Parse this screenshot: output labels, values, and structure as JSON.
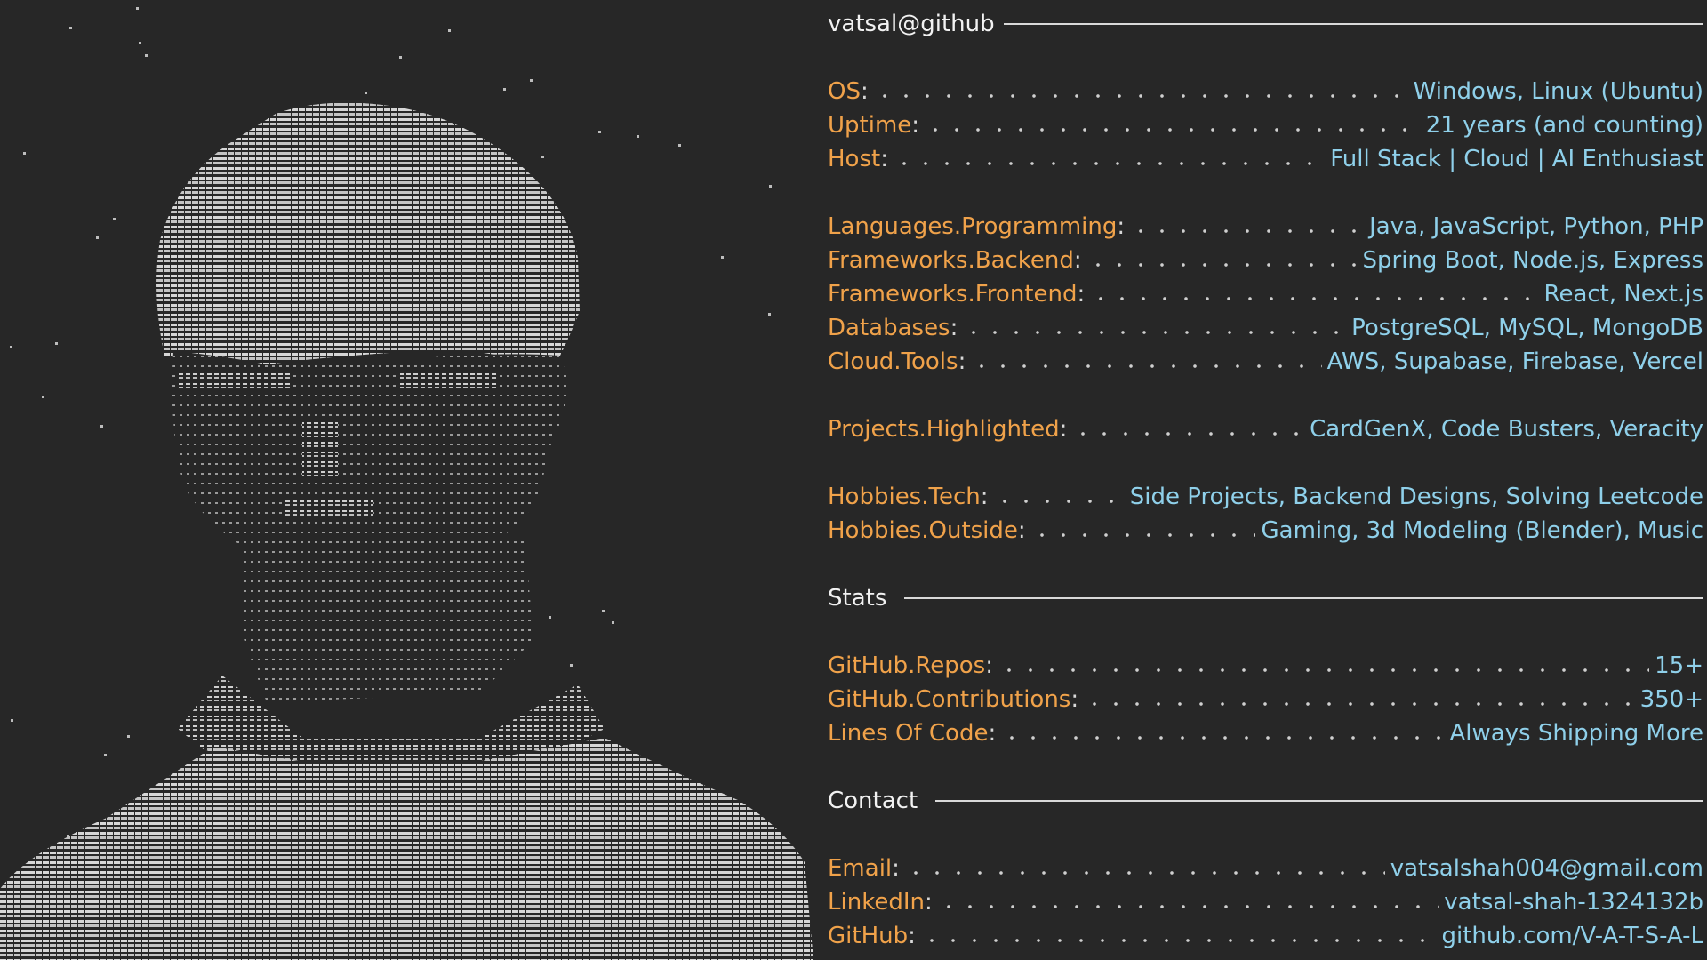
{
  "header": {
    "title": "vatsal@github"
  },
  "system": [
    {
      "key": "OS",
      "value": "Windows, Linux (Ubuntu)"
    },
    {
      "key": "Uptime",
      "value": "21 years (and counting)"
    },
    {
      "key": "Host",
      "value": "Full Stack | Cloud | AI Enthusiast"
    }
  ],
  "stack": [
    {
      "key": "Languages.Programming",
      "value": "Java, JavaScript, Python, PHP"
    },
    {
      "key": "Frameworks.Backend",
      "value": "Spring Boot, Node.js, Express"
    },
    {
      "key": "Frameworks.Frontend",
      "value": "React, Next.js"
    },
    {
      "key": "Databases",
      "value": "PostgreSQL, MySQL, MongoDB"
    },
    {
      "key": "Cloud.Tools",
      "value": "AWS, Supabase, Firebase, Vercel"
    }
  ],
  "projects": [
    {
      "key": "Projects.Highlighted",
      "value": "CardGenX,  Code Busters, Veracity"
    }
  ],
  "hobbies": [
    {
      "key": "Hobbies.Tech",
      "value": "Side Projects, Backend Designs, Solving Leetcode"
    },
    {
      "key": "Hobbies.Outside",
      "value": "Gaming, 3d Modeling (Blender), Music"
    }
  ],
  "stats": {
    "title": "Stats",
    "items": [
      {
        "key": "GitHub.Repos",
        "value": "15+"
      },
      {
        "key": "GitHub.Contributions",
        "value": "350+"
      },
      {
        "key": "Lines Of Code",
        "value": "Always Shipping More"
      }
    ]
  },
  "contact": {
    "title": "Contact",
    "items": [
      {
        "key": "Email",
        "value": "vatsalshah004@gmail.com"
      },
      {
        "key": "LinkedIn",
        "value": "vatsal-shah-1324132b"
      },
      {
        "key": "GitHub",
        "value": "github.com/V-A-T-S-A-L"
      }
    ]
  },
  "colors": {
    "background": "#272727",
    "key": "#f0a24a",
    "value": "#8fd0ea",
    "text": "#f2f2f2",
    "ascii": "#c8c8c8"
  },
  "icons": {
    "portrait": "ascii-art-portrait"
  }
}
